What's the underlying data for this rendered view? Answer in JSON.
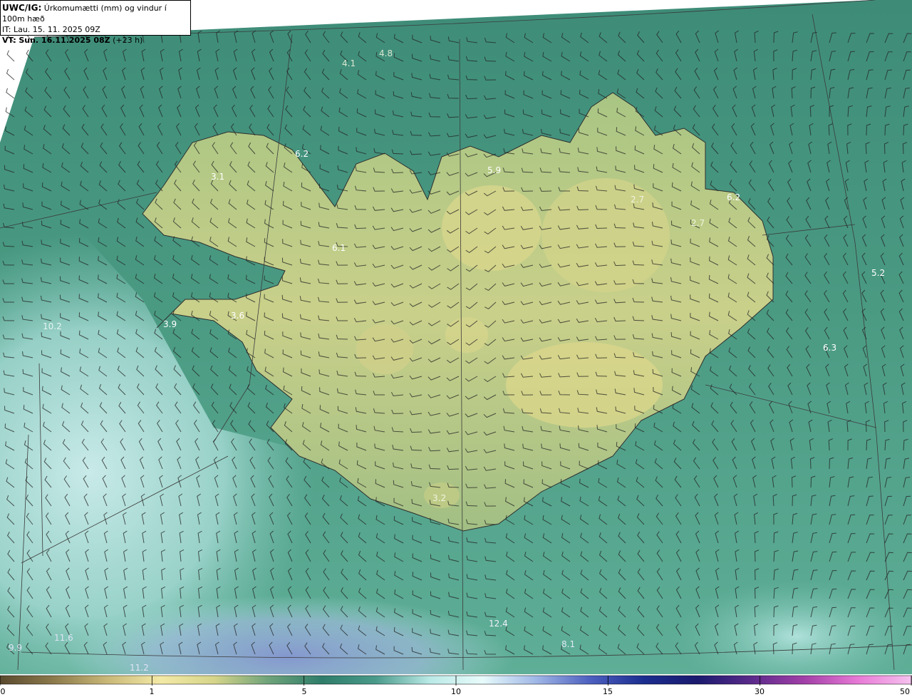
{
  "header": {
    "model": "UWC/IG:",
    "title": "Úrkomumætti (mm) og vindur í 100m hæð",
    "it_prefix": "IT:",
    "it_value": "Lau. 15. 11. 2025 09Z",
    "vt_prefix": "VT:",
    "vt_value": "Sun. 16.11.2025 08Z",
    "vt_lead": "(+23 h)"
  },
  "colors": {
    "sea_deep": "#2e7d6a",
    "sea_mid": "#3f8f7a",
    "low": "#b9e3e0",
    "lower": "#7ec9c0",
    "blue": "#8fa0d8",
    "land_low": "#9bc07a",
    "land_high": "#d6d58a",
    "contour": "#3a3a3a",
    "barb": "#222222"
  },
  "map_values": [
    {
      "text": "4.1"
    },
    {
      "text": "4.8"
    },
    {
      "text": "6.2"
    },
    {
      "text": "3.1"
    },
    {
      "text": "5.9"
    },
    {
      "text": "2.7"
    },
    {
      "text": "6.2"
    },
    {
      "text": "2.7"
    },
    {
      "text": "6.1"
    },
    {
      "text": "5.2"
    },
    {
      "text": "3.6"
    },
    {
      "text": "3.9"
    },
    {
      "text": "10.2"
    },
    {
      "text": "6.3"
    },
    {
      "text": "3.2"
    },
    {
      "text": "12.4"
    },
    {
      "text": "11.6"
    },
    {
      "text": "9.9"
    },
    {
      "text": "8.1"
    },
    {
      "text": "11.2"
    }
  ],
  "colorbar": {
    "ticks": [
      "0",
      "1",
      "5",
      "10",
      "15",
      "30",
      "50"
    ],
    "stops": [
      "#5a4a2e",
      "#8c7a4c",
      "#c9b878",
      "#f3e9a6",
      "#d6d58a",
      "#6fa37a",
      "#2e7d6a",
      "#4a9a8a",
      "#b9e9e6",
      "#e8fbfb",
      "#9fb7e6",
      "#4d5fbf",
      "#1b2d8f",
      "#1a1a6e",
      "#5a2a8a",
      "#a23fa8",
      "#e87ad6",
      "#f6c3ef"
    ]
  }
}
